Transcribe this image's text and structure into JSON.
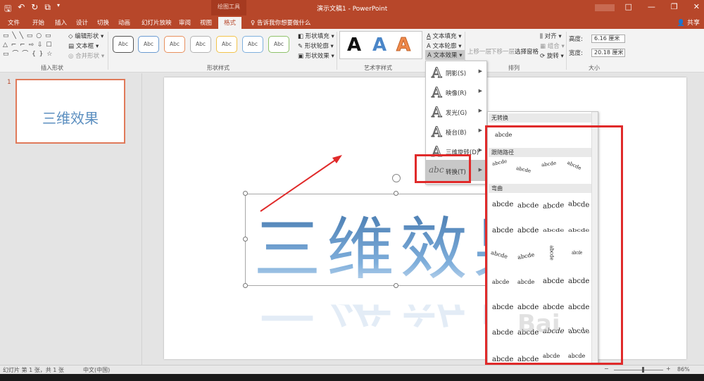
{
  "titlebar": {
    "qat_icons": [
      "save-icon",
      "undo-icon",
      "redo-icon",
      "present-icon",
      "customize-icon"
    ],
    "context_tab": "绘图工具",
    "doc_title": "演示文稿1 - PowerPoint",
    "window_buttons": [
      "□",
      "—",
      "❐",
      "✕"
    ]
  },
  "tabs": [
    "文件",
    "开始",
    "插入",
    "设计",
    "切换",
    "动画",
    "幻灯片放映",
    "审阅",
    "视图",
    "格式"
  ],
  "active_tab": "格式",
  "tellme": "告诉我你想要做什么",
  "share": "共享",
  "ribbon": {
    "insert_shapes": {
      "shapes_glyphs": "▭ ╲ ╲ ▭ ○ ▭\n△ ⌐ ⌐ ⇨ ⇩ ☐\n▭ ⌒ ⌒ { } ☆",
      "edit_shape": "编辑形状",
      "textbox": "文本框",
      "merge_shapes": "合并形状",
      "label": "插入形状"
    },
    "shape_styles": {
      "sample": "Abc",
      "fill": "形状填充",
      "outline": "形状轮廓",
      "effects": "形状效果",
      "label": "形状样式"
    },
    "wordart": {
      "letters": [
        "A",
        "A",
        "A"
      ],
      "text_fill": "文本填充",
      "text_outline": "文本轮廓",
      "text_effects": "文本效果",
      "label": "艺术字样式"
    },
    "arrange": {
      "bring_forward": "上移一层",
      "send_backward": "下移一层",
      "selection_pane": "选择窗格",
      "align": "对齐",
      "group": "组合",
      "rotate": "旋转",
      "label": "排列"
    },
    "size": {
      "height_label": "高度:",
      "height_value": "6.16 厘米",
      "width_label": "宽度:",
      "width_value": "20.18 厘米",
      "label": "大小"
    }
  },
  "thumbs": {
    "number": "1",
    "text": "三维效果"
  },
  "slide": {
    "text": "三维效果"
  },
  "text_effects_menu": [
    {
      "label": "阴影(S)"
    },
    {
      "label": "映像(R)"
    },
    {
      "label": "发光(G)"
    },
    {
      "label": "棱台(B)"
    },
    {
      "label": "三维旋转(D)"
    },
    {
      "label": "转换(T)",
      "icon_text": "abc"
    }
  ],
  "transform_gallery": {
    "no_transform": "无转换",
    "sample": "abcde",
    "follow_path": "跟随路径",
    "warp": "弯曲"
  },
  "statusbar": {
    "slide_info": "幻灯片 第 1 张，共 1 张",
    "language": "中文(中国)",
    "zoom": "86%"
  },
  "colors": {
    "accent": "#b7472a",
    "highlight_box": "#e02a2a",
    "text_blue": "#6b9bd1"
  }
}
